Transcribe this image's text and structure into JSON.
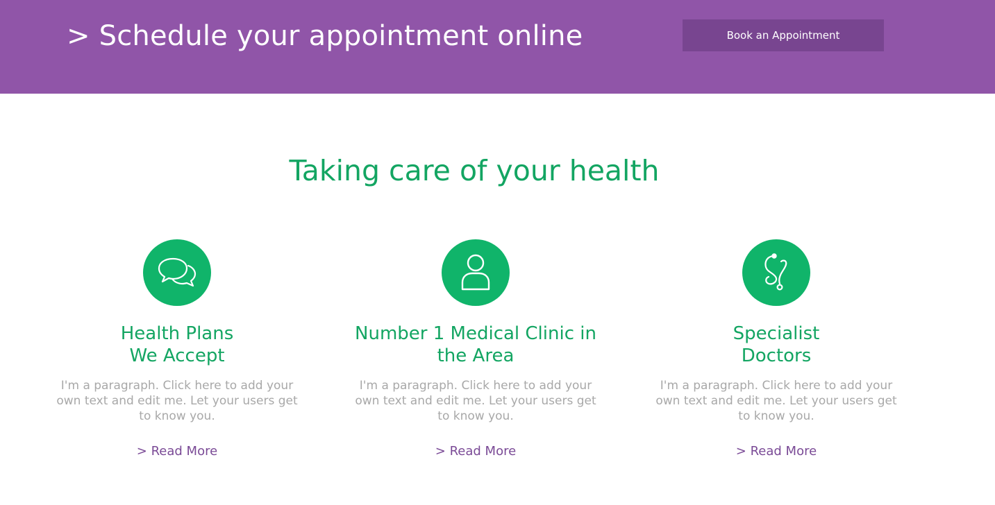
{
  "banner": {
    "title": "> Schedule your appointment online",
    "button_label": "Book an Appointment",
    "color": "#9055a8",
    "button_color": "#784590"
  },
  "section": {
    "title": "Taking care of your health",
    "accent_color": "#13a562"
  },
  "features": [
    {
      "icon": "chat-bubbles-icon",
      "title_line1": "Health Plans",
      "title_line2": "We Accept",
      "text": "I'm a paragraph. Click here to add your own text and edit me. Let your users get to know you.",
      "link": "> Read More"
    },
    {
      "icon": "person-icon",
      "title_line1": "Number 1 Medical Clinic in",
      "title_line2": "the Area",
      "text": "I'm a paragraph. Click here to add your own text and edit me. Let your users get to know you.",
      "link": "> Read More"
    },
    {
      "icon": "stethoscope-icon",
      "title_line1": "Specialist",
      "title_line2": "Doctors",
      "text": "I'm a paragraph. Click here to add your own text and edit me. Let your users get to know you.",
      "link": "> Read More"
    }
  ]
}
